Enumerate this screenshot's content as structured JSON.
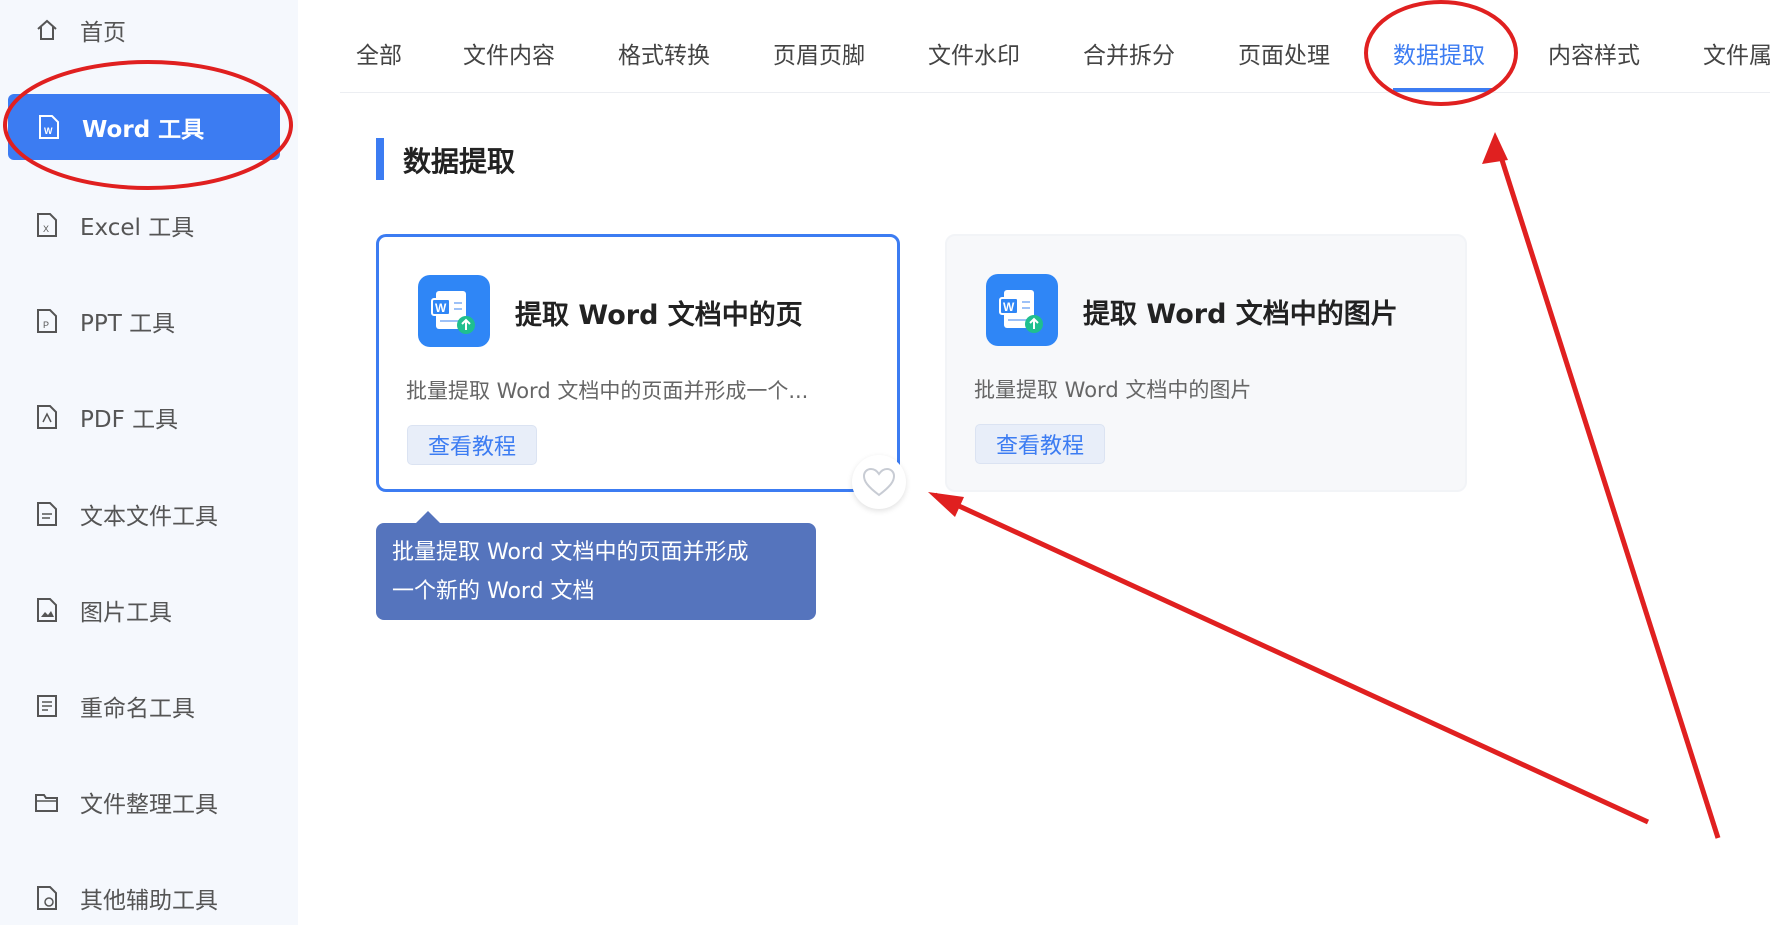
{
  "sidebar": {
    "items": [
      {
        "label": "首页",
        "icon": "home-icon"
      },
      {
        "label": "Word 工具",
        "icon": "word-file-icon",
        "active": true
      },
      {
        "label": "Excel 工具",
        "icon": "excel-file-icon"
      },
      {
        "label": "PPT 工具",
        "icon": "ppt-file-icon"
      },
      {
        "label": "PDF 工具",
        "icon": "pdf-file-icon"
      },
      {
        "label": "文本文件工具",
        "icon": "text-file-icon"
      },
      {
        "label": "图片工具",
        "icon": "image-file-icon"
      },
      {
        "label": "重命名工具",
        "icon": "rename-icon"
      },
      {
        "label": "文件整理工具",
        "icon": "folder-icon"
      },
      {
        "label": "其他辅助工具",
        "icon": "other-tools-icon"
      }
    ]
  },
  "tabs": [
    {
      "label": "全部"
    },
    {
      "label": "文件内容"
    },
    {
      "label": "格式转换"
    },
    {
      "label": "页眉页脚"
    },
    {
      "label": "文件水印"
    },
    {
      "label": "合并拆分"
    },
    {
      "label": "页面处理"
    },
    {
      "label": "数据提取",
      "active": true
    },
    {
      "label": "内容样式"
    },
    {
      "label": "文件属"
    }
  ],
  "section": {
    "title": "数据提取"
  },
  "cards": [
    {
      "title": "提取 Word 文档中的页",
      "desc": "批量提取 Word 文档中的页面并形成一个...",
      "button": "查看教程",
      "icon": "word-extract-icon"
    },
    {
      "title": "提取 Word 文档中的图片",
      "desc": "批量提取 Word 文档中的图片",
      "button": "查看教程",
      "icon": "word-extract-icon"
    }
  ],
  "tooltip": {
    "line1": "批量提取 Word 文档中的页面并形成",
    "line2": "一个新的 Word 文档"
  },
  "colors": {
    "accent": "#3c7cf2",
    "sidebar_bg": "#f5f8fd",
    "tooltip_bg": "#5574bd",
    "annotation": "#e02020"
  }
}
